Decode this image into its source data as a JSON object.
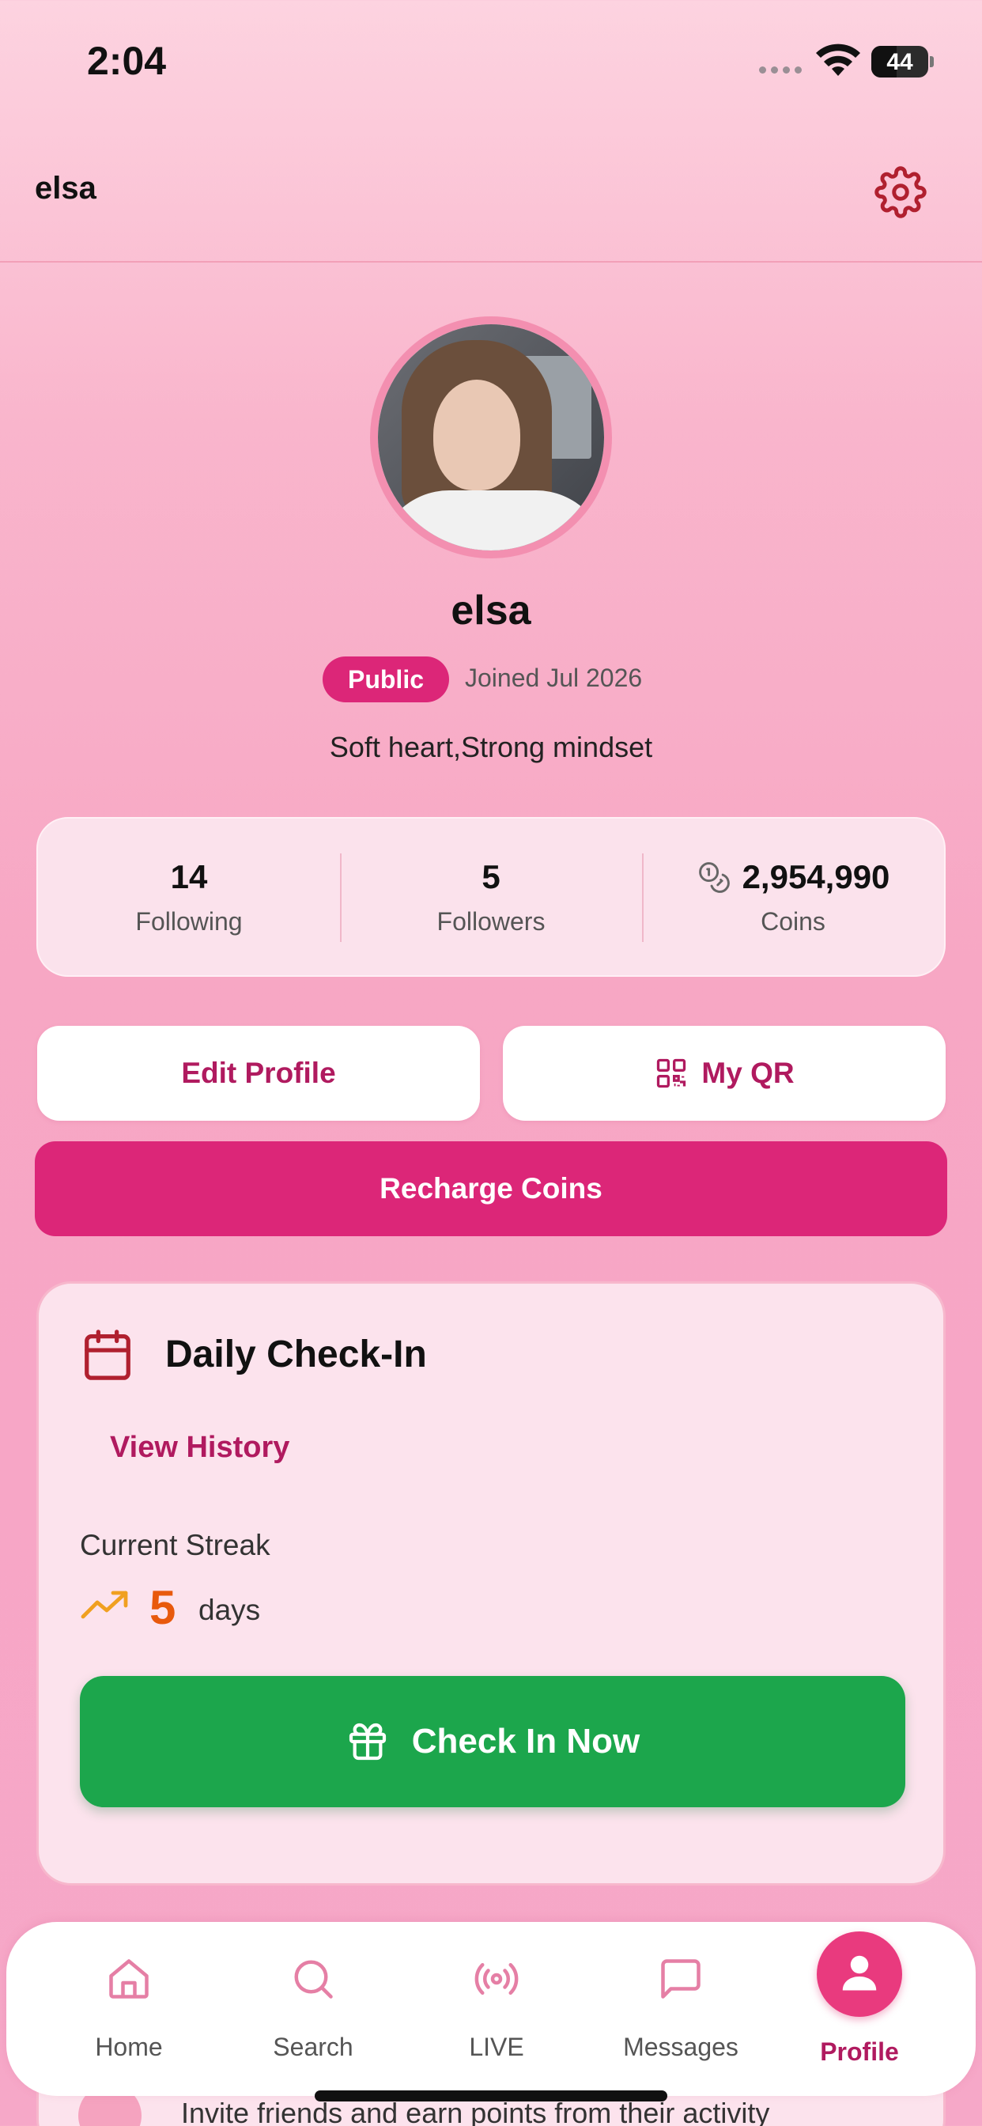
{
  "status_bar": {
    "time": "2:04",
    "battery": "44",
    "battery_level": 0.44
  },
  "header": {
    "title": "elsa",
    "settings_icon": "gear-icon"
  },
  "profile": {
    "name": "elsa",
    "visibility_badge": "Public",
    "joined": "Joined Jul 2026",
    "bio": "Soft heart,Strong mindset"
  },
  "stats": [
    {
      "value": "14",
      "label": "Following"
    },
    {
      "value": "5",
      "label": "Followers"
    },
    {
      "value": "2,954,990",
      "label": "Coins",
      "icon": "coins-icon"
    }
  ],
  "actions": {
    "edit_profile": "Edit Profile",
    "my_qr": "My QR",
    "recharge": "Recharge Coins"
  },
  "checkin": {
    "title": "Daily Check-In",
    "view_history": "View History",
    "streak_label": "Current Streak",
    "streak_value": "5",
    "streak_unit": "days",
    "button": "Check In Now"
  },
  "peek_text": "Invite friends and earn points from their activity",
  "nav": {
    "items": [
      {
        "label": "Home",
        "icon": "home-icon"
      },
      {
        "label": "Search",
        "icon": "search-icon"
      },
      {
        "label": "LIVE",
        "icon": "live-icon"
      },
      {
        "label": "Messages",
        "icon": "messages-icon"
      },
      {
        "label": "Profile",
        "icon": "profile-icon",
        "active": true
      }
    ]
  },
  "colors": {
    "accent": "#dc2678",
    "accent_dark": "#b01a5f",
    "checkin_green": "#1ca64c",
    "streak_orange": "#e8590c"
  }
}
